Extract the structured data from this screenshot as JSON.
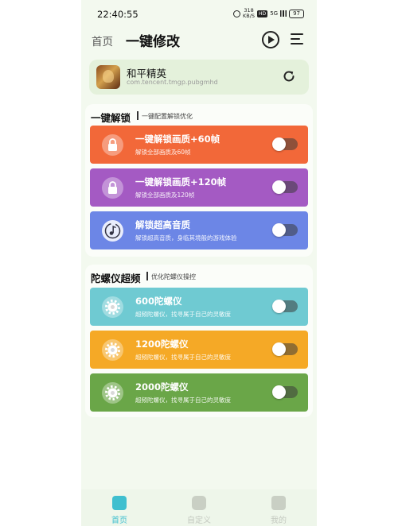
{
  "status_bar": {
    "time": "22:40:55",
    "speed_value": "318",
    "speed_unit": "KB/S",
    "hd": "HD",
    "signal": "5G",
    "battery": "97"
  },
  "header": {
    "home_link": "首页",
    "title": "一键修改"
  },
  "game": {
    "name": "和平精英",
    "package": "com.tencent.tmgp.pubgmhd"
  },
  "sections": [
    {
      "title": "一键解锁",
      "subtitle": "一键配置解锁优化",
      "items": [
        {
          "title": "一键解锁画质+60帧",
          "desc": "解锁全部画质及60帧",
          "color": "#f26839",
          "icon": "lock-icon"
        },
        {
          "title": "一键解锁画质+120帧",
          "desc": "解锁全部画质及120帧",
          "color": "#a45ac3",
          "icon": "lock-icon"
        },
        {
          "title": "解锁超高音质",
          "desc": "解锁超高音质，身临其境般的游戏体验",
          "color": "#6c86e6",
          "icon": "music-note-icon"
        }
      ]
    },
    {
      "title": "陀螺仪超频",
      "subtitle": "优化陀螺仪操控",
      "items": [
        {
          "title": "600陀螺仪",
          "desc": "超频陀螺仪，找寻属于自己的灵敏度",
          "color": "#6fcad2",
          "icon": "gear-icon"
        },
        {
          "title": "1200陀螺仪",
          "desc": "超频陀螺仪，找寻属于自己的灵敏度",
          "color": "#f5a926",
          "icon": "gear-icon"
        },
        {
          "title": "2000陀螺仪",
          "desc": "超频陀螺仪，找寻属于自己的灵敏度",
          "color": "#6aa648",
          "icon": "gear-icon"
        }
      ]
    }
  ],
  "bottom_nav": [
    {
      "label": "首页",
      "active": true
    },
    {
      "label": "自定义",
      "active": false
    },
    {
      "label": "我的",
      "active": false
    }
  ],
  "colors": {
    "accent": "#3fbfcf",
    "background": "#f3f9ef"
  }
}
